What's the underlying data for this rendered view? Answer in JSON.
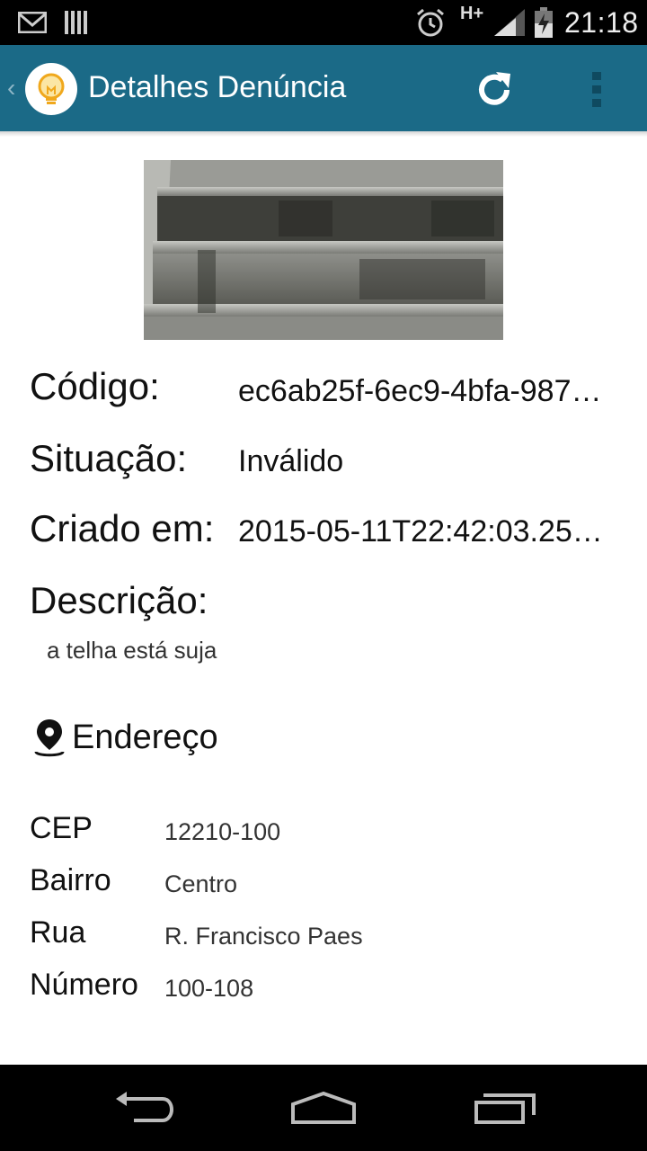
{
  "status_bar": {
    "time": "21:18",
    "network_type": "H+",
    "icons": [
      "gmail-icon",
      "storage-bars-icon",
      "alarm-icon",
      "signal-icon",
      "battery-icon"
    ]
  },
  "action_bar": {
    "title": "Detalhes Denúncia",
    "icons": [
      "back-chevron-icon",
      "lightbulb-logo-icon",
      "refresh-icon",
      "overflow-menu-icon"
    ]
  },
  "details": {
    "codigo_label": "Código:",
    "codigo_value": "ec6ab25f-6ec9-4bfa-987…",
    "situacao_label": "Situação:",
    "situacao_value": "Inválido",
    "criado_label": "Criado em:",
    "criado_value": "2015-05-11T22:42:03.25…",
    "descricao_label": "Descrição:",
    "descricao_value": "a telha está suja"
  },
  "address": {
    "title": "Endereço",
    "icon": "location-pin-icon",
    "cep_label": "CEP",
    "cep_value": "12210-100",
    "bairro_label": "Bairro",
    "bairro_value": "Centro",
    "rua_label": "Rua",
    "rua_value": "R. Francisco Paes",
    "numero_label": "Número",
    "numero_value": "100-108"
  },
  "nav_bar": {
    "icons": [
      "back-icon",
      "home-icon",
      "recents-icon"
    ]
  },
  "colors": {
    "action_bar": "#1b6a87",
    "status_bar": "#000000",
    "nav_bar": "#000000"
  }
}
